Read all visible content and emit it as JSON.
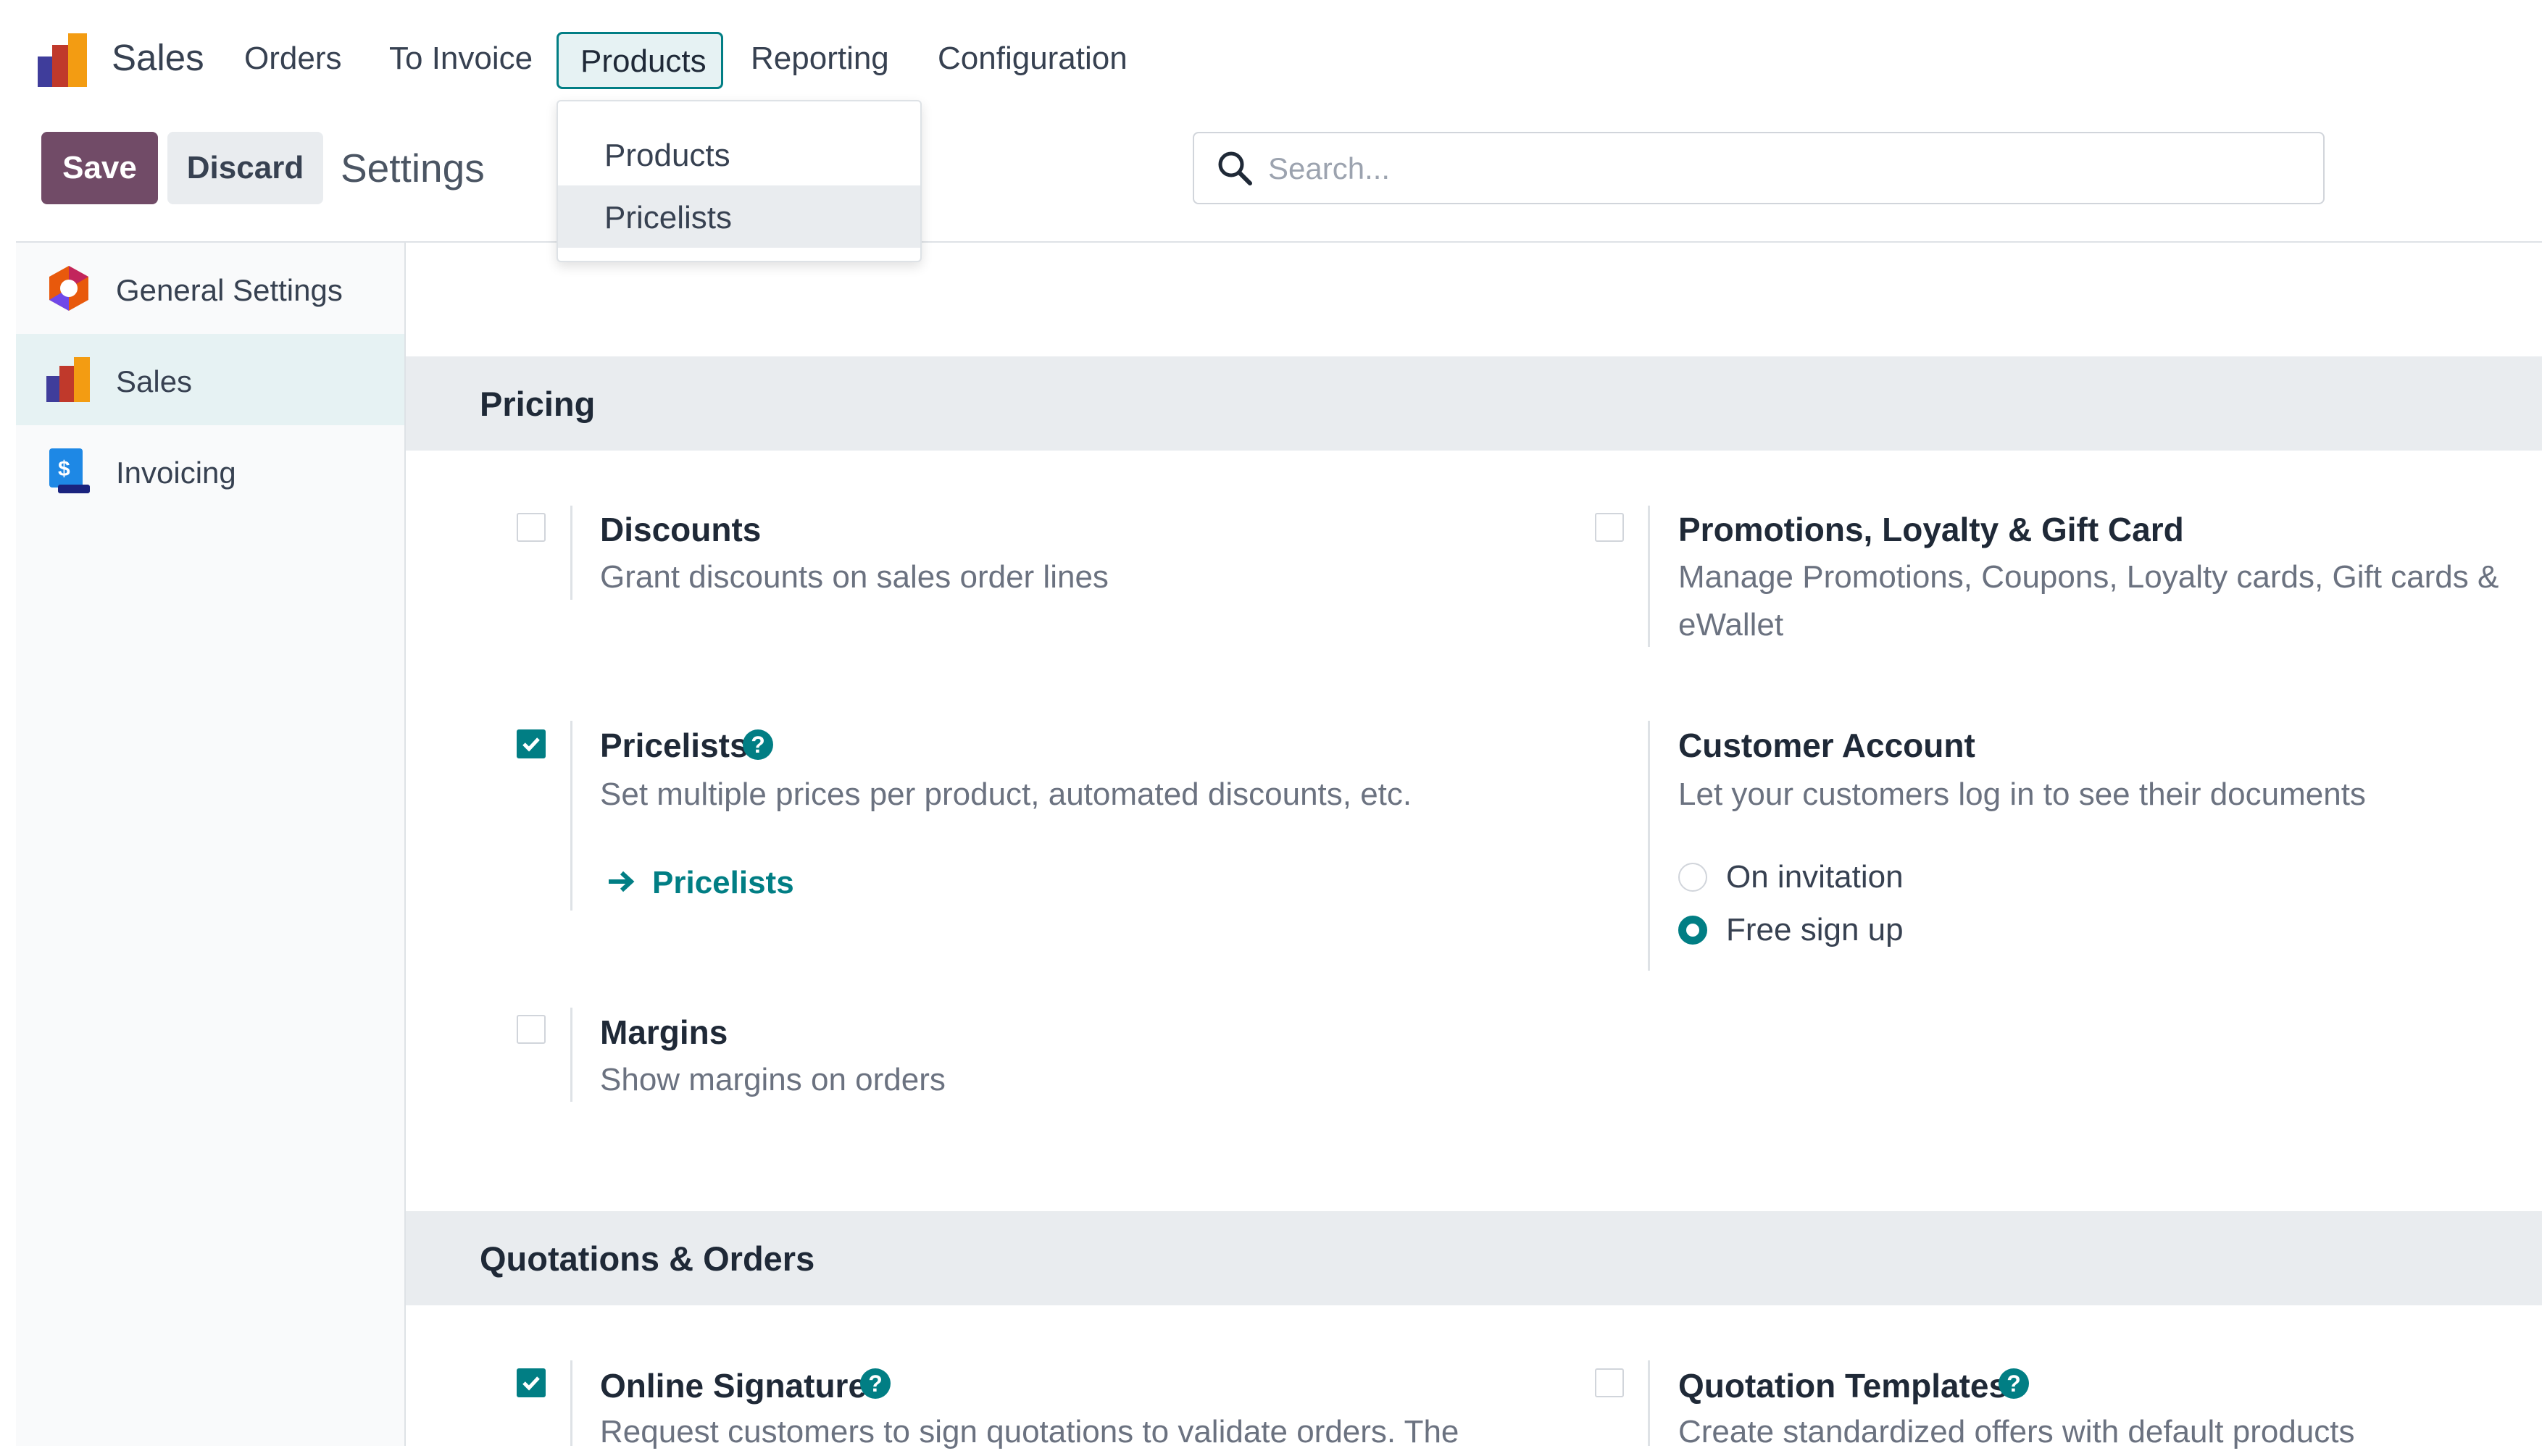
{
  "app": {
    "name": "Sales"
  },
  "nav": {
    "items": [
      "Orders",
      "To Invoice",
      "Products",
      "Reporting",
      "Configuration"
    ]
  },
  "toolbar": {
    "save_label": "Save",
    "discard_label": "Discard",
    "title": "Settings"
  },
  "search": {
    "placeholder": "Search..."
  },
  "products_menu": {
    "items": [
      "Products",
      "Pricelists"
    ],
    "highlighted": "Pricelists"
  },
  "sidebar": {
    "items": [
      {
        "label": "General Settings",
        "icon": "general-settings-icon"
      },
      {
        "label": "Sales",
        "icon": "sales-app-icon",
        "active": true
      },
      {
        "label": "Invoicing",
        "icon": "invoicing-app-icon"
      }
    ]
  },
  "sections": [
    {
      "title": "Pricing",
      "settings": {
        "discounts": {
          "title": "Discounts",
          "desc": "Grant discounts on sales order lines",
          "checked": false
        },
        "promotions": {
          "title": "Promotions, Loyalty & Gift Card",
          "desc_line1": "Manage Promotions, Coupons, Loyalty cards, Gift cards &",
          "desc_line2": "eWallet",
          "checked": false
        },
        "pricelists": {
          "title": "Pricelists",
          "desc": "Set multiple prices per product, automated discounts, etc.",
          "checked": true,
          "link_label": "Pricelists"
        },
        "customer_account": {
          "title": "Customer Account",
          "desc": "Let your customers log in to see their documents",
          "options": [
            "On invitation",
            "Free sign up"
          ],
          "selected": "Free sign up"
        },
        "margins": {
          "title": "Margins",
          "desc": "Show margins on orders",
          "checked": false
        }
      }
    },
    {
      "title": "Quotations & Orders",
      "settings": {
        "online_signature": {
          "title": "Online Signature",
          "desc": "Request customers to sign quotations to validate orders. The",
          "checked": true
        },
        "quotation_templates": {
          "title": "Quotation Templates",
          "desc": "Create standardized offers with default products",
          "checked": false
        }
      }
    }
  ],
  "colors": {
    "accent": "#017e84",
    "brand": "#714b67",
    "section_bg": "#e9ecef"
  }
}
